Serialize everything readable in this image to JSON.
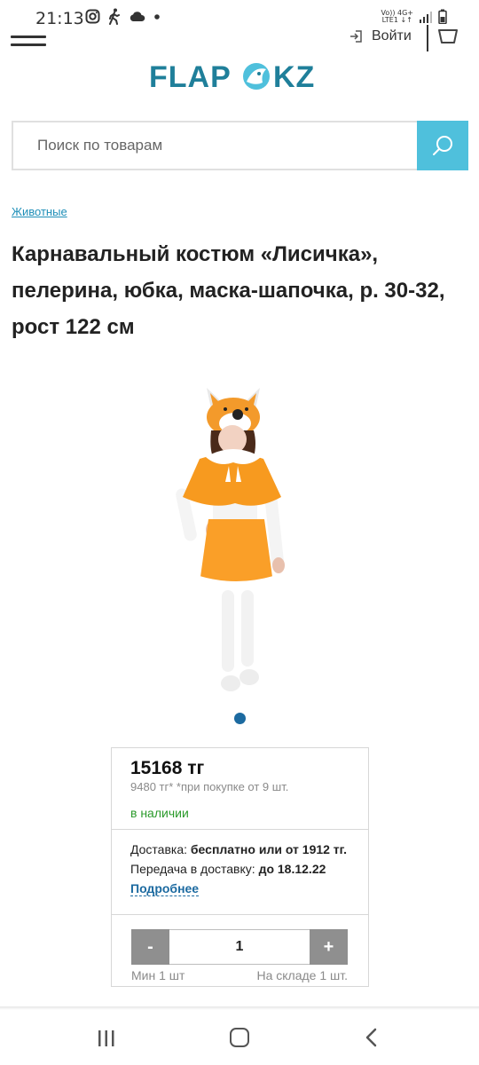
{
  "status_bar": {
    "time": "21:13",
    "net_top": "Vo)) 4G+",
    "net_bottom": "LTE1 ↓↑"
  },
  "header": {
    "login_label": "Войти",
    "logo_text": "FLAPOKZ",
    "brand_color": "#1f7f9a"
  },
  "search": {
    "placeholder": "Поиск по товарам",
    "button_color": "#4fc0dc"
  },
  "breadcrumb": "Животные",
  "product": {
    "title": "Карнавальный костюм «Лисичка», пелерина, юбка, маска-шапочка, р. 30-32, рост 122 см",
    "price": "15168 тг",
    "bulk_price_note": "9480 тг* *при покупке от 9 шт.",
    "stock_status": "в наличии",
    "delivery_label": "Доставка:",
    "delivery_value": "бесплатно или от 1912 тг.",
    "handover_label": "Передача в доставку:",
    "handover_value": "до 18.12.22",
    "more_link": "Подробнее",
    "qty_minus": "-",
    "qty_value": "1",
    "qty_plus": "+",
    "min_qty": "Мин 1 шт",
    "warehouse": "На складе 1 шт."
  }
}
